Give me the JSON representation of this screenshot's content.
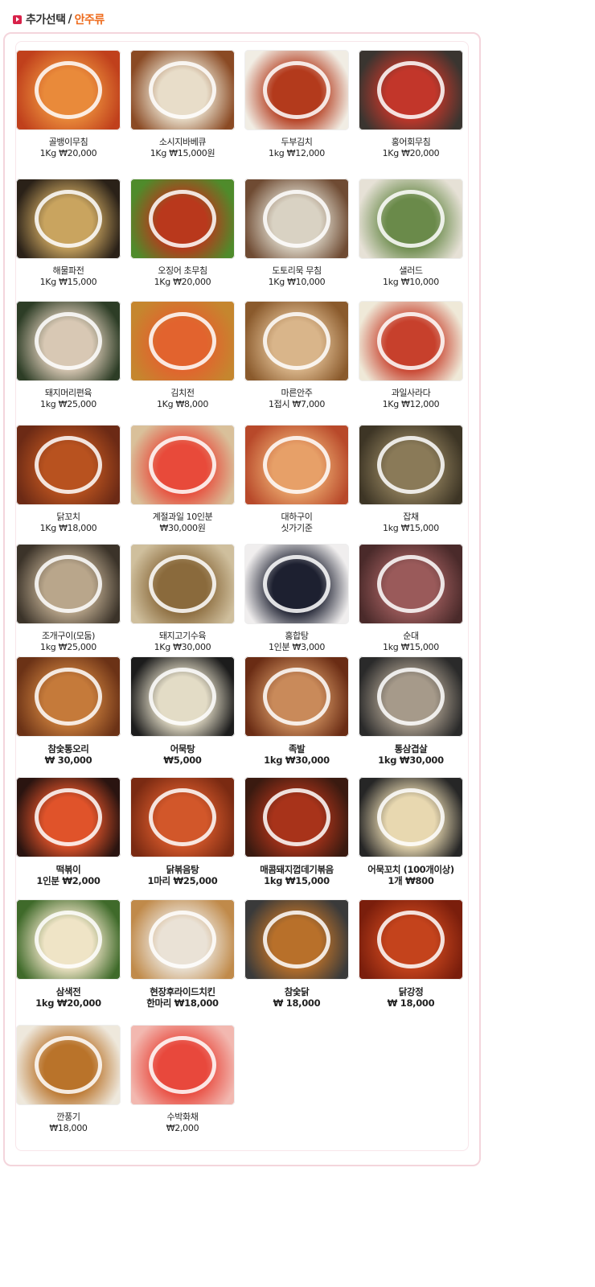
{
  "header": {
    "title": "추가선택",
    "separator": "/",
    "subtitle": "안주류"
  },
  "accent_colors": {
    "title": "#333333",
    "subtitle": "#ee6a1b",
    "bullet": "#d8224a",
    "panel_border": "#f4d5dc"
  },
  "items": [
    {
      "name": "골뱅이무침",
      "price": "1Kg ₩20,000",
      "colors": [
        "#c0401c",
        "#e98a3a"
      ],
      "icon": "food-photo"
    },
    {
      "name": "소시지바베큐",
      "price": "1Kg  ₩15,000원",
      "colors": [
        "#8a4a24",
        "#e8ddc9"
      ],
      "icon": "food-photo"
    },
    {
      "name": "두부김치",
      "price": "1kg ₩12,000",
      "colors": [
        "#f1ede4",
        "#b33a1c"
      ],
      "icon": "food-photo"
    },
    {
      "name": "홍어회무침",
      "price": "1Kg ₩20,000",
      "colors": [
        "#3a3530",
        "#c2362a"
      ],
      "icon": "food-photo"
    },
    {
      "name": "해물파전",
      "price": "1Kg ₩15,000",
      "colors": [
        "#2a2118",
        "#c9a45f"
      ],
      "icon": "food-photo"
    },
    {
      "name": "오징어 초무침",
      "price": "1Kg ₩20,000",
      "colors": [
        "#4f8b2b",
        "#b9381c"
      ],
      "icon": "food-photo"
    },
    {
      "name": "도토리묵 무침",
      "price": "1Kg ₩10,000",
      "colors": [
        "#6f4b33",
        "#d9d2c3"
      ],
      "icon": "food-photo"
    },
    {
      "name": "샐러드",
      "price": "1kg  ₩10,000",
      "colors": [
        "#e6e1d6",
        "#6a8a4a"
      ],
      "icon": "food-photo"
    },
    {
      "name": "돼지머리편육",
      "price": "1kg ₩25,000",
      "colors": [
        "#2d3d26",
        "#d8c8b4"
      ],
      "icon": "food-photo"
    },
    {
      "name": "김치전",
      "price": "1Kg ₩8,000",
      "colors": [
        "#c5862e",
        "#e2632e"
      ],
      "icon": "food-photo"
    },
    {
      "name": "마른안주",
      "price": "1접시 ₩7,000",
      "colors": [
        "#8a5a2c",
        "#d9b58a"
      ],
      "icon": "food-photo"
    },
    {
      "name": "과일사라다",
      "price": "1Kg ₩12,000",
      "colors": [
        "#efe9d8",
        "#c7402c"
      ],
      "icon": "food-photo"
    },
    {
      "name": "닭꼬치",
      "price": "1Kg ₩18,000",
      "colors": [
        "#6c2a15",
        "#b8521f"
      ],
      "icon": "food-photo"
    },
    {
      "name": "계절과일  10인분",
      "price": "₩30,000원",
      "colors": [
        "#d9c09a",
        "#e84a3a"
      ],
      "icon": "food-photo"
    },
    {
      "name": "대하구이",
      "price": "싯가기준",
      "colors": [
        "#b8492a",
        "#e7a068"
      ],
      "icon": "food-photo"
    },
    {
      "name": "잡채",
      "price": "1kg ₩15,000",
      "colors": [
        "#3d3525",
        "#8a7a58"
      ],
      "icon": "food-photo"
    },
    {
      "name": "조개구이(모둠)",
      "price": "1kg ₩25,000",
      "colors": [
        "#3b3329",
        "#b9a68b"
      ],
      "icon": "food-photo"
    },
    {
      "name": "돼지고기수육",
      "price": "1Kg ₩30,000",
      "colors": [
        "#cfbf9d",
        "#8a6a3c"
      ],
      "icon": "food-photo"
    },
    {
      "name": "홍합탕",
      "price": "1인분 ₩3,000",
      "colors": [
        "#f0eeee",
        "#1d2030"
      ],
      "icon": "food-photo"
    },
    {
      "name": "순대",
      "price": "1kg ₩15,000",
      "colors": [
        "#4a2a2a",
        "#9a5a5a"
      ],
      "icon": "food-photo"
    },
    {
      "name": "참숯통오리",
      "price": "₩ 30,000",
      "colors": [
        "#6b3216",
        "#c57a3a"
      ],
      "icon": "food-photo"
    },
    {
      "name": "어묵탕",
      "price": "₩5,000",
      "colors": [
        "#1c1c1c",
        "#e3dcc6"
      ],
      "icon": "food-photo"
    },
    {
      "name": "족발",
      "price": "1kg   ₩30,000",
      "colors": [
        "#6a2c14",
        "#c98a5a"
      ],
      "icon": "food-photo"
    },
    {
      "name": "통삼겹살",
      "price": "1kg   ₩30,000",
      "colors": [
        "#2a2a2a",
        "#a69a8a"
      ],
      "icon": "food-photo"
    },
    {
      "name": "떡볶이",
      "price": "1인분  ₩2,000",
      "colors": [
        "#2a1410",
        "#e0532a"
      ],
      "icon": "food-photo"
    },
    {
      "name": "닭볶음탕",
      "price": "1마리  ₩25,000",
      "colors": [
        "#7a2a12",
        "#d2572a"
      ],
      "icon": "food-photo"
    },
    {
      "name": "매콤돼지껍데기볶음",
      "price": "1kg   ₩15,000",
      "colors": [
        "#3a1a10",
        "#a8331a"
      ],
      "icon": "food-photo"
    },
    {
      "name": "어묵꼬치 (100개이상)",
      "price": "1개 ₩800",
      "colors": [
        "#262626",
        "#e8d8b0"
      ],
      "icon": "food-photo"
    },
    {
      "name": "삼색전",
      "price": "1kg   ₩20,000",
      "colors": [
        "#3f6a2a",
        "#efe4c6"
      ],
      "icon": "food-photo"
    },
    {
      "name": "현장후라이드치킨",
      "price": "한마리  ₩18,000",
      "colors": [
        "#c08a4a",
        "#eae2d6"
      ],
      "icon": "food-photo"
    },
    {
      "name": "참숯닭",
      "price": "₩ 18,000",
      "colors": [
        "#3a3a3a",
        "#b8702a"
      ],
      "icon": "food-photo"
    },
    {
      "name": "닭강정",
      "price": "₩ 18,000",
      "colors": [
        "#7a1e0c",
        "#c4431c"
      ],
      "icon": "food-photo"
    },
    {
      "name": "깐풍기",
      "price": "₩18,000",
      "colors": [
        "#eee8dc",
        "#b9732a"
      ],
      "icon": "food-photo"
    },
    {
      "name": "수박화채",
      "price": "₩2,000",
      "colors": [
        "#f2b8b0",
        "#e8483c"
      ],
      "icon": "food-photo"
    }
  ]
}
